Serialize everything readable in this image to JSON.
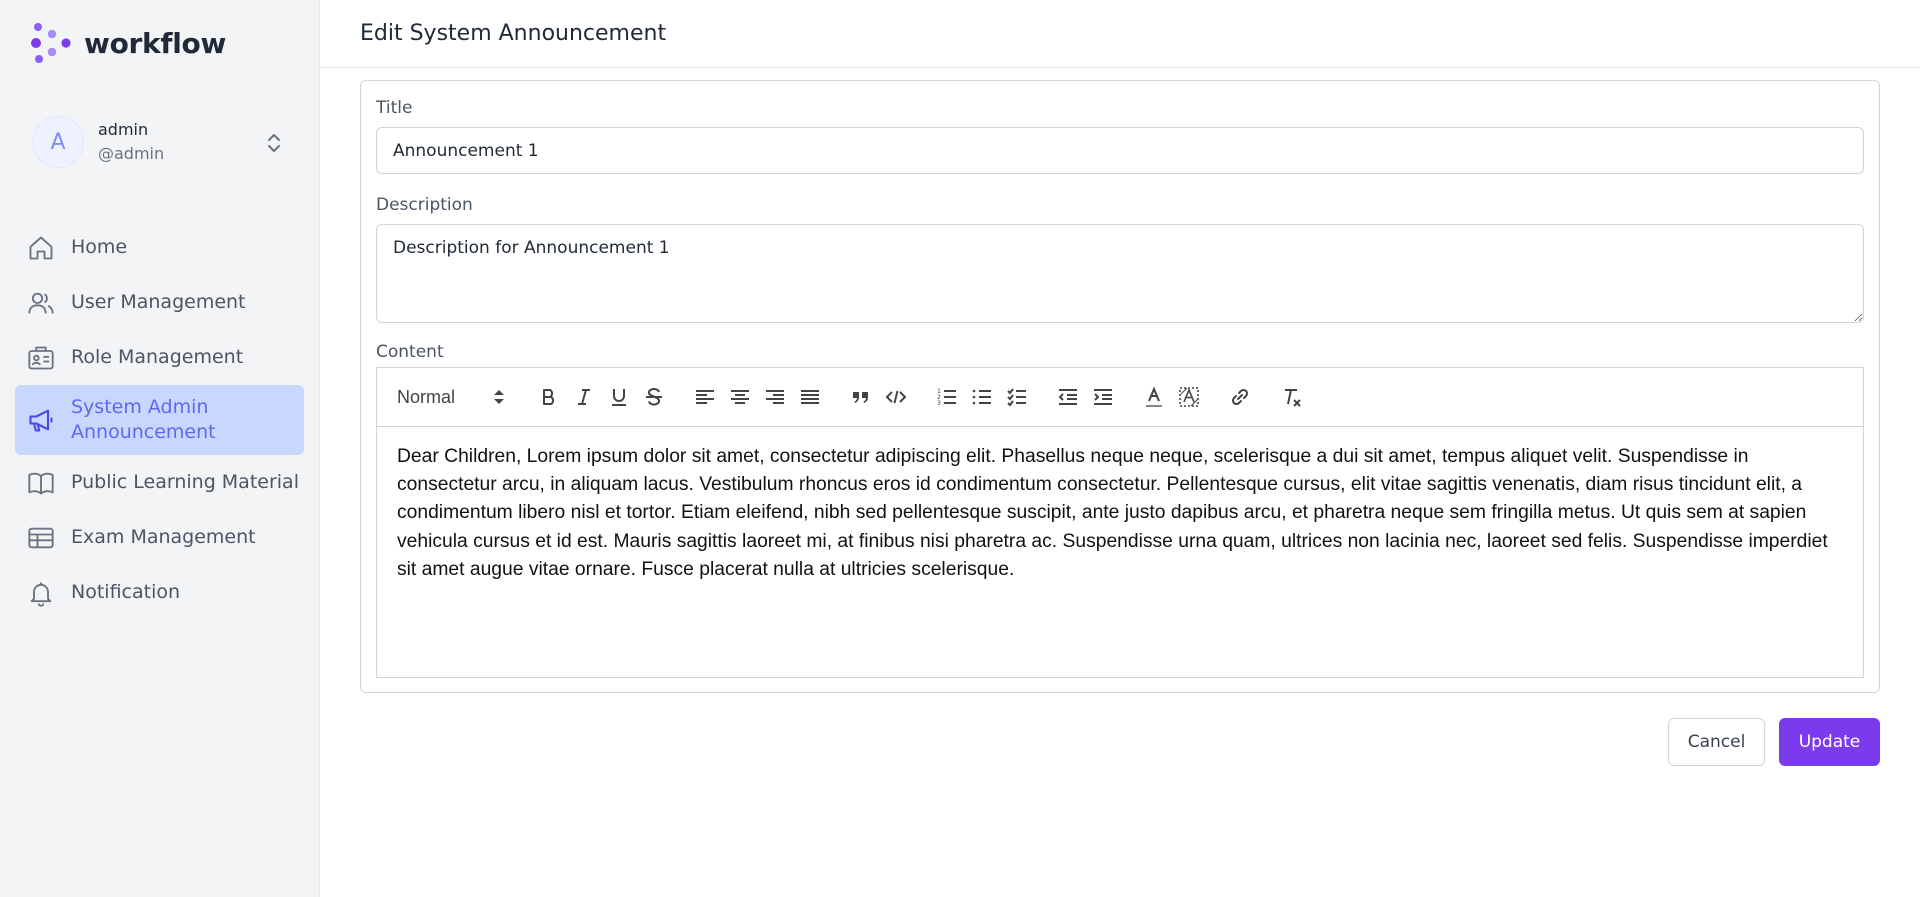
{
  "brand": {
    "name": "workflow",
    "accent": "#7c3aed"
  },
  "user": {
    "initial": "A",
    "name": "admin",
    "handle": "@admin"
  },
  "sidebar": {
    "items": [
      {
        "label": "Home",
        "icon": "home-icon"
      },
      {
        "label": "User Management",
        "icon": "users-icon"
      },
      {
        "label": "Role Management",
        "icon": "id-card-icon"
      },
      {
        "label": "System Admin Announcement",
        "icon": "megaphone-icon",
        "active": true
      },
      {
        "label": "Public Learning Material",
        "icon": "book-icon"
      },
      {
        "label": "Exam Management",
        "icon": "table-icon"
      },
      {
        "label": "Notification",
        "icon": "bell-icon"
      }
    ],
    "active_color": "#c7d7fd"
  },
  "header": {
    "title": "Edit System Announcement"
  },
  "form": {
    "title_label": "Title",
    "title_value": "Announcement 1",
    "description_label": "Description",
    "description_value": "Description for Announcement 1",
    "content_label": "Content",
    "editor": {
      "format_select": "Normal",
      "toolbar_icons": [
        "bold-icon",
        "italic-icon",
        "underline-icon",
        "strikethrough-icon",
        "align-left-icon",
        "align-center-icon",
        "align-right-icon",
        "align-justify-icon",
        "blockquote-icon",
        "code-block-icon",
        "ordered-list-icon",
        "bullet-list-icon",
        "check-list-icon",
        "outdent-icon",
        "indent-icon",
        "text-color-icon",
        "background-color-icon",
        "link-icon",
        "clear-format-icon"
      ],
      "body": "Dear Children, Lorem ipsum dolor sit amet, consectetur adipiscing elit. Phasellus neque neque, scelerisque a dui sit amet, tempus aliquet velit. Suspendisse in consectetur arcu, in aliquam lacus. Vestibulum rhoncus eros id condimentum consectetur. Pellentesque cursus, elit vitae sagittis venenatis, diam risus tincidunt elit, a condimentum libero nisl et tortor. Etiam eleifend, nibh sed pellentesque suscipit, ante justo dapibus arcu, et pharetra neque sem fringilla metus. Ut quis sem at sapien vehicula cursus et id est. Mauris sagittis laoreet mi, at finibus nisi pharetra ac. Suspendisse urna quam, ultrices non lacinia nec, laoreet sed felis. Suspendisse imperdiet sit amet augue vitae ornare. Fusce placerat nulla at ultricies scelerisque."
    }
  },
  "actions": {
    "cancel_label": "Cancel",
    "update_label": "Update"
  }
}
